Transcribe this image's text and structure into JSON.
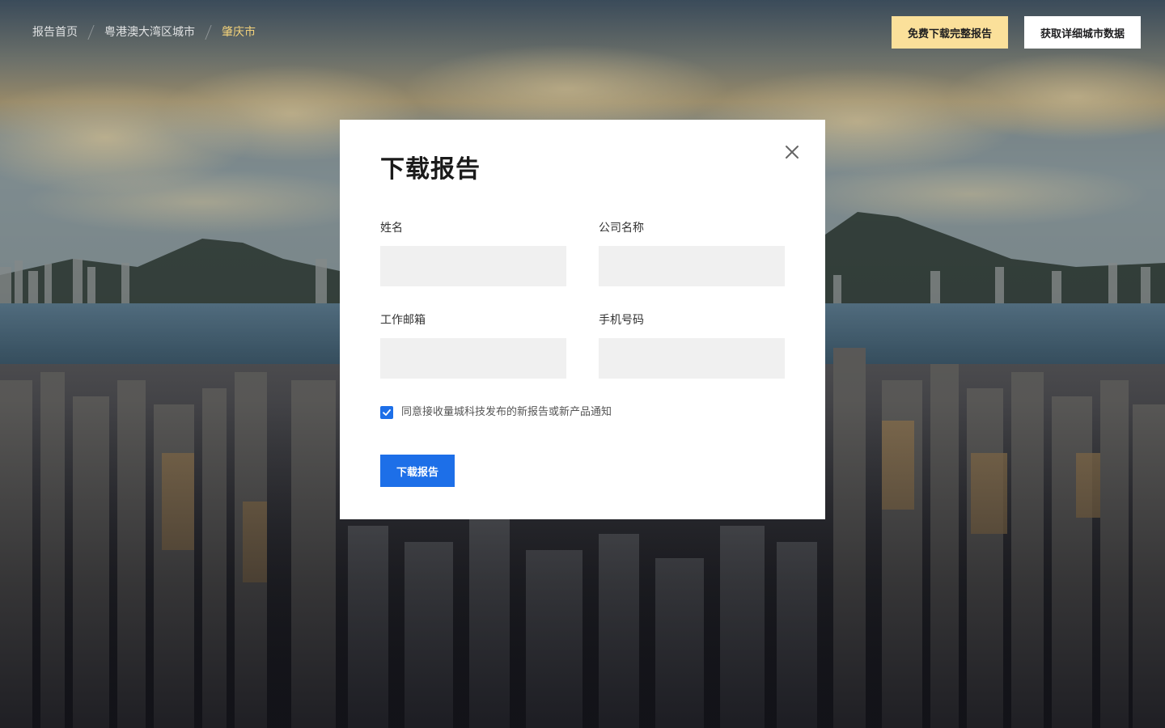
{
  "breadcrumb": {
    "items": [
      {
        "label": "报告首页"
      },
      {
        "label": "粤港澳大湾区城市"
      },
      {
        "label": "肇庆市"
      }
    ]
  },
  "header": {
    "free_download_label": "免费下载完整报告",
    "city_data_label": "获取详细城市数据"
  },
  "modal": {
    "title": "下载报告",
    "close_icon": "close-icon",
    "fields": {
      "name": {
        "label": "姓名",
        "value": "",
        "placeholder": ""
      },
      "company": {
        "label": "公司名称",
        "value": "",
        "placeholder": ""
      },
      "email": {
        "label": "工作邮箱",
        "value": "",
        "placeholder": ""
      },
      "phone": {
        "label": "手机号码",
        "value": "",
        "placeholder": ""
      }
    },
    "consent": {
      "checked": true,
      "label": "同意接收量城科技发布的新报告或新产品通知"
    },
    "submit_label": "下载报告"
  },
  "colors": {
    "accent": "#1d6fe8",
    "highlight": "#fbe09a",
    "breadcrumb_current": "#f3d27a",
    "input_bg": "#f0f0f0"
  }
}
